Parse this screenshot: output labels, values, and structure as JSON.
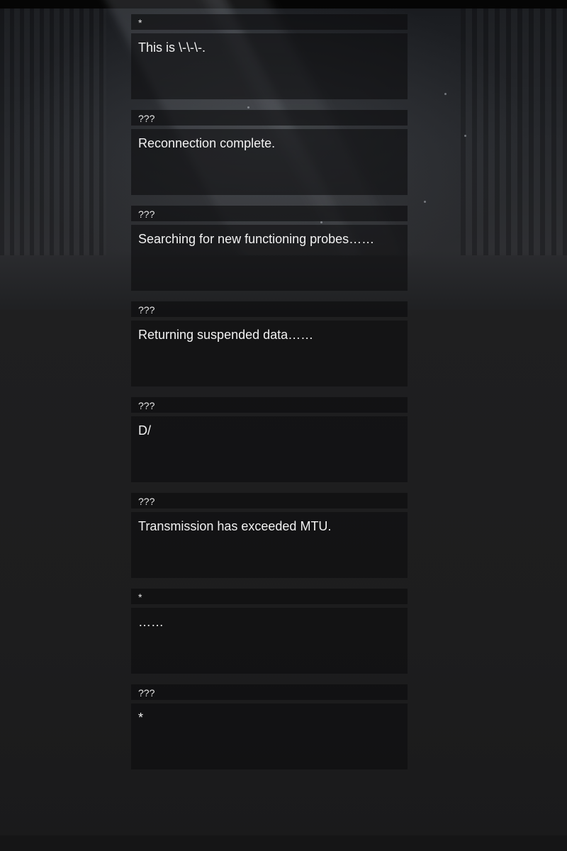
{
  "dialogue_log": {
    "entries": [
      {
        "speaker": "*",
        "text": "This is \\-\\-\\-."
      },
      {
        "speaker": "???",
        "text": "Reconnection complete."
      },
      {
        "speaker": "???",
        "text": "Searching for new functioning probes……"
      },
      {
        "speaker": "???",
        "text": "Returning suspended data……"
      },
      {
        "speaker": "???",
        "text": "D/"
      },
      {
        "speaker": "???",
        "text": "Transmission has exceeded MTU."
      },
      {
        "speaker": "*",
        "text": "……"
      },
      {
        "speaker": "???",
        "text": "*"
      }
    ]
  },
  "colors": {
    "panel": "#0c0c0d",
    "text": "#f2f2f2",
    "speaker_text": "#e6e6e6"
  }
}
